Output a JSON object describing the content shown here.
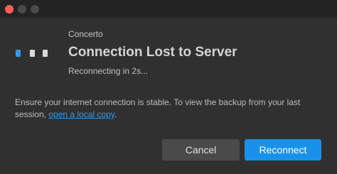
{
  "window": {
    "titlebar_buttons": [
      "close",
      "minimize",
      "maximize"
    ]
  },
  "dialog": {
    "app_name": "Concerto",
    "title": "Connection Lost to Server",
    "subtitle": "Reconnecting in 2s...",
    "message_prefix": "Ensure your internet connection is stable. To view the backup from your last session, ",
    "message_link": "open a local copy",
    "message_suffix": "."
  },
  "buttons": {
    "cancel_label": "Cancel",
    "reconnect_label": "Reconnect"
  },
  "colors": {
    "accent": "#1991ea",
    "link": "#2f9bf0",
    "close_button": "#ff5f57",
    "background": "#303030"
  }
}
